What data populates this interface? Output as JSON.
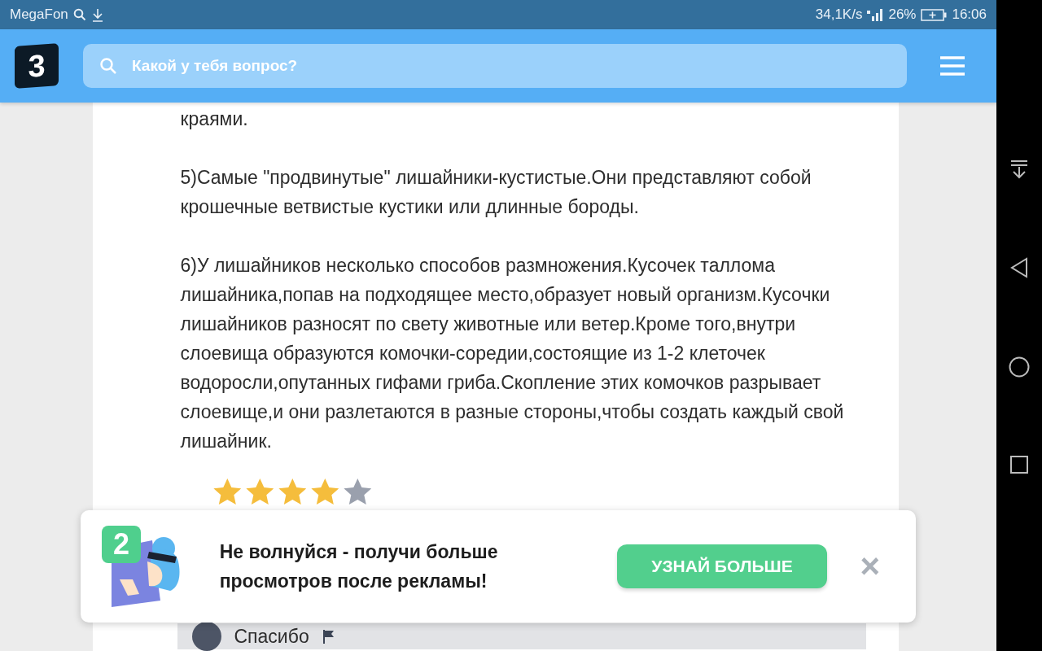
{
  "status_bar": {
    "carrier": "MegaFon",
    "speed": "34,1K/s",
    "battery": "26%",
    "time": "16:06"
  },
  "header": {
    "logo": "3",
    "search": {
      "placeholder": "Какой у тебя вопрос?"
    }
  },
  "answer": {
    "paragraphs": [
      "краями.",
      "5)Самые \"продвинутые\" лишайники-кустистые.Они представляют собой крошечные ветвистые кустики или длинные бороды.",
      "6)У лишайников несколько способов размножения.Кусочек таллома лишайника,попав на подходящее место,образует новый организм.Кусочки лишайников разносят по свету животные или ветер.Кроме того,внутри слоевища образуются комочки-соредии,состоящие из 1-2 клеточек водоросли,опутанных гифами гриба.Скопление этих комочков разрывает слоевище,и они разлетаются в разные стороны,чтобы создать каждый свой лишайник."
    ],
    "stars": 4,
    "thanks": "Спасибо"
  },
  "banner": {
    "badge": "2",
    "message": "Не волнуйся - получи больше просмотров после рекламы!",
    "button": "УЗНАЙ БОЛЬШЕ",
    "close": "×"
  }
}
